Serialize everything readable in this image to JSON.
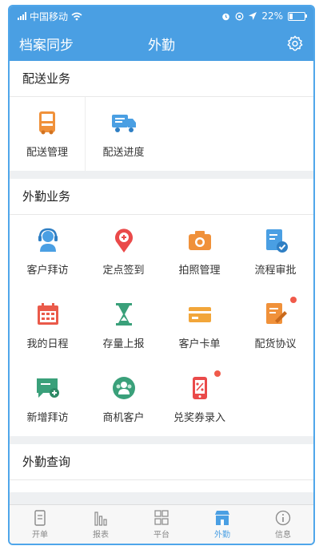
{
  "status_bar": {
    "carrier": "中国移动",
    "battery": "22%"
  },
  "nav": {
    "left_label": "档案同步",
    "title": "外勤"
  },
  "sections": {
    "delivery": {
      "title": "配送业务",
      "items": [
        {
          "label": "配送管理"
        },
        {
          "label": "配送进度"
        }
      ]
    },
    "field": {
      "title": "外勤业务",
      "items": [
        {
          "label": "客户拜访"
        },
        {
          "label": "定点签到"
        },
        {
          "label": "拍照管理"
        },
        {
          "label": "流程审批"
        },
        {
          "label": "我的日程"
        },
        {
          "label": "存量上报"
        },
        {
          "label": "客户卡单"
        },
        {
          "label": "配货协议"
        },
        {
          "label": "新增拜访"
        },
        {
          "label": "商机客户"
        },
        {
          "label": "兑奖券录入"
        }
      ]
    },
    "query": {
      "title": "外勤查询"
    }
  },
  "tabs": [
    {
      "label": "开单"
    },
    {
      "label": "报表"
    },
    {
      "label": "平台"
    },
    {
      "label": "外勤"
    },
    {
      "label": "信息"
    }
  ],
  "colors": {
    "primary": "#4a9fe3",
    "badge": "#f05a4a"
  }
}
